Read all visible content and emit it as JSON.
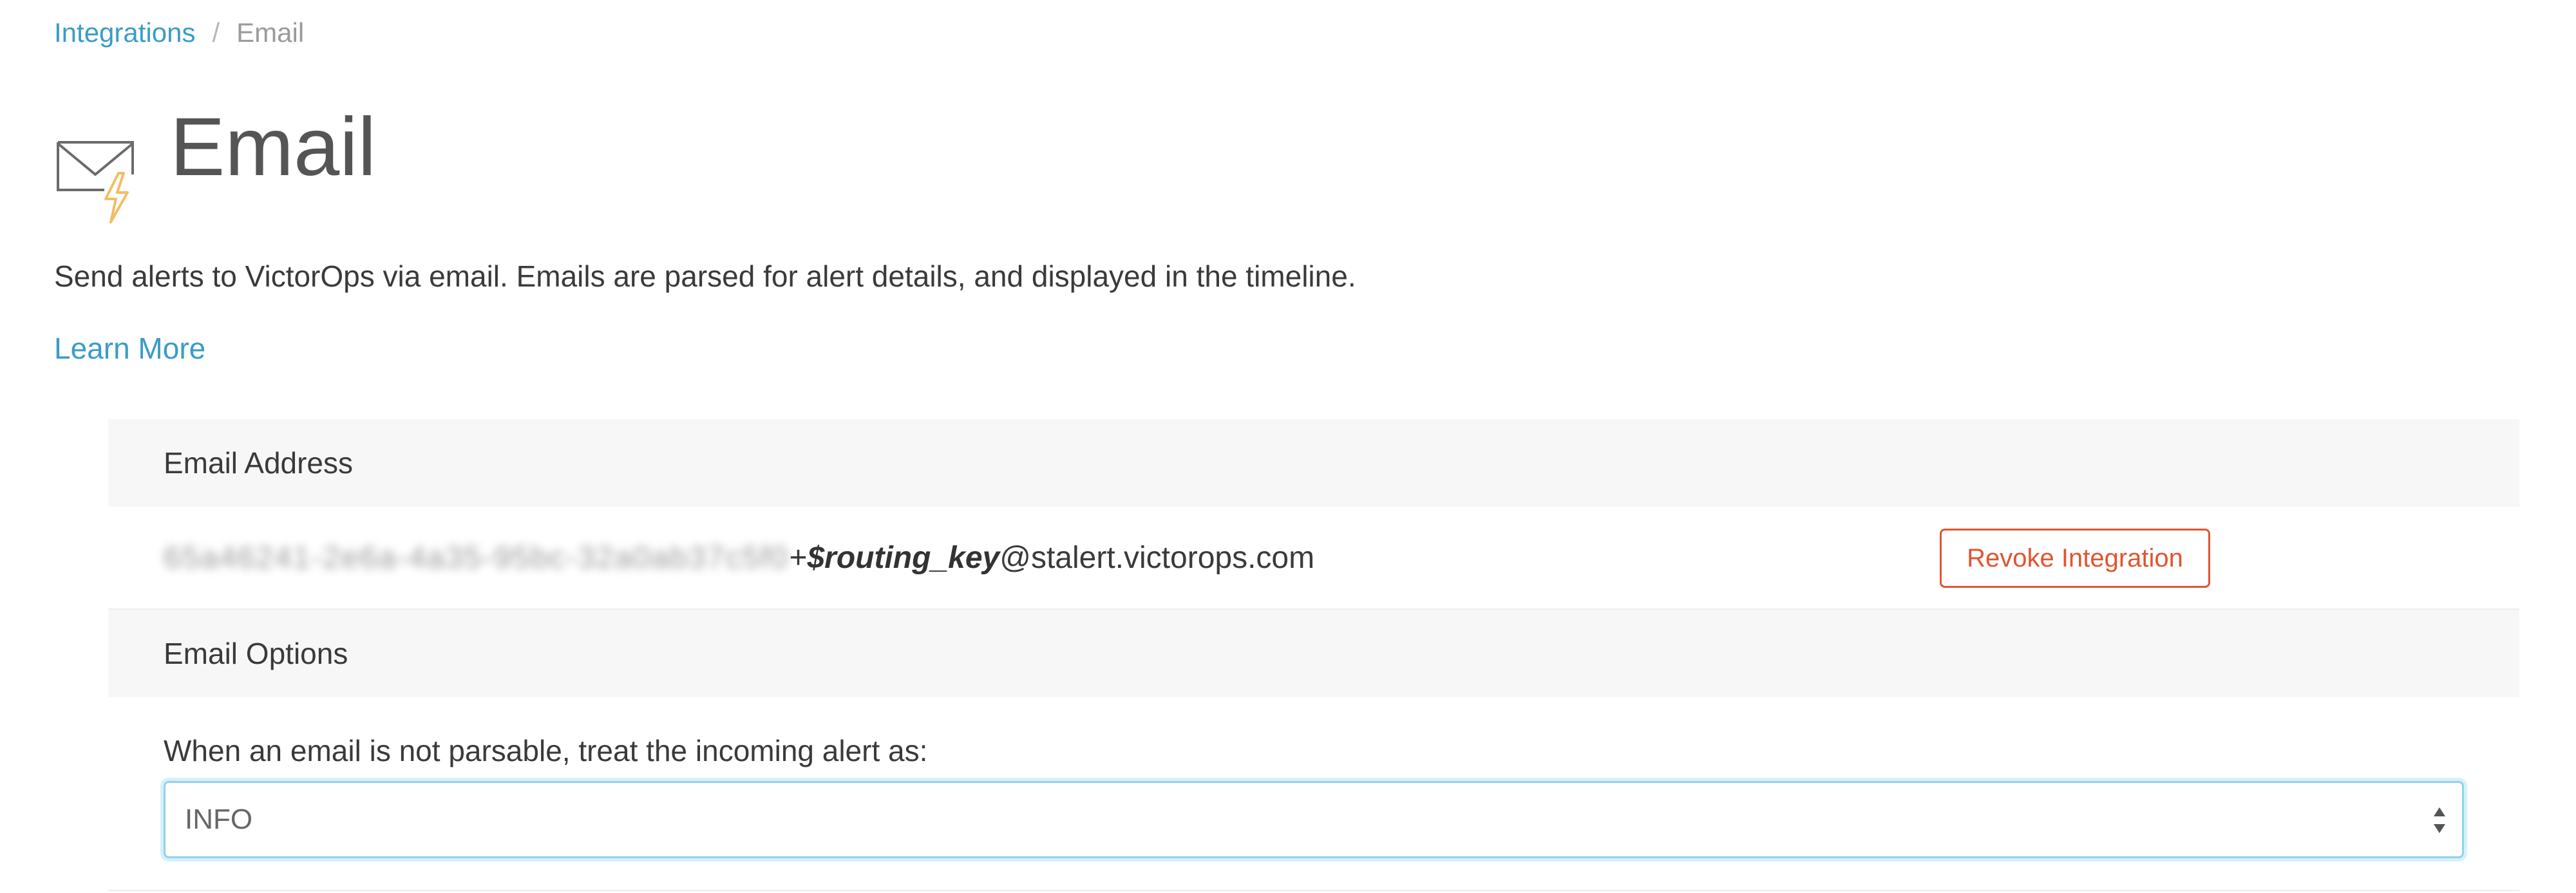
{
  "breadcrumb": {
    "parent": "Integrations",
    "separator": "/",
    "current": "Email"
  },
  "header": {
    "title": "Email",
    "icon": "envelope-lightning-icon"
  },
  "description": "Send alerts to VictorOps via email. Emails are parsed for alert details, and displayed in the timeline.",
  "learn_more": "Learn More",
  "email_address": {
    "section_title": "Email Address",
    "address_prefix": "65a46241-2e6a-4a35-95bc-32a0ab37c5f0",
    "plus": "+",
    "routing_key": "$routing_key",
    "domain": "@stalert.victorops.com",
    "revoke_label": "Revoke Integration"
  },
  "email_options": {
    "section_title": "Email Options",
    "unparsable_label": "When an email is not parsable, treat the incoming alert as:",
    "selected_value": "INFO"
  },
  "colors": {
    "link": "#3a9cc8",
    "revoke": "#e0552f",
    "focus": "#8fd3ee"
  }
}
